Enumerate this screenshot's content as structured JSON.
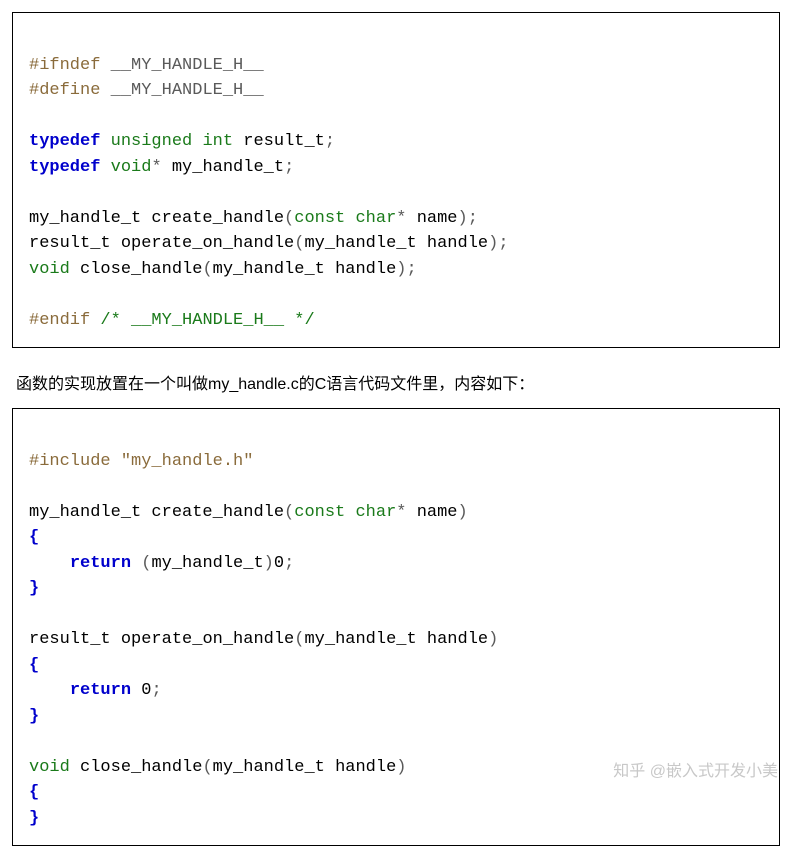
{
  "block1": {
    "l1": {
      "pp": "#ifndef",
      "mac": " __MY_HANDLE_H__"
    },
    "l2": {
      "pp": "#define",
      "mac": " __MY_HANDLE_H__"
    },
    "l3": "",
    "l4": {
      "kw": "typedef",
      "sp1": " ",
      "t1": "unsigned",
      "sp2": " ",
      "t2": "int",
      "sp3": " ",
      "id": "result_t",
      "semi": ";"
    },
    "l5": {
      "kw": "typedef",
      "sp1": " ",
      "t1": "void",
      "star": "*",
      "sp2": " ",
      "id": "my_handle_t",
      "semi": ";"
    },
    "l6": "",
    "l7": {
      "ret": "my_handle_t ",
      "fn": "create_handle",
      "op": "(",
      "ckw": "const",
      "sp1": " ",
      "ch": "char",
      "star": "*",
      "sp2": " ",
      "arg": "name",
      "cp": ")",
      "semi": ";"
    },
    "l8": {
      "ret": "result_t ",
      "fn": "operate_on_handle",
      "op": "(",
      "argtype": "my_handle_t ",
      "arg": "handle",
      "cp": ")",
      "semi": ";"
    },
    "l9": {
      "ret": "void",
      "sp": " ",
      "fn": "close_handle",
      "op": "(",
      "argtype": "my_handle_t ",
      "arg": "handle",
      "cp": ")",
      "semi": ";"
    },
    "l10": "",
    "l11": {
      "pp": "#endif",
      "sp": " ",
      "cmt": "/* __MY_HANDLE_H__ */"
    }
  },
  "prose": "函数的实现放置在一个叫做my_handle.c的C语言代码文件里，内容如下：",
  "block2": {
    "l1": {
      "pp": "#include",
      "sp": " ",
      "str": "\"my_handle.h\""
    },
    "l2": "",
    "l3": {
      "ret": "my_handle_t ",
      "fn": "create_handle",
      "op": "(",
      "ckw": "const",
      "sp1": " ",
      "ch": "char",
      "star": "*",
      "sp2": " ",
      "arg": "name",
      "cp": ")"
    },
    "l4": {
      "brace": "{"
    },
    "l5": {
      "indent": "    ",
      "kw": "return",
      "sp": " ",
      "op": "(",
      "cast": "my_handle_t",
      "cp": ")",
      "val": "0",
      "semi": ";"
    },
    "l6": {
      "brace": "}"
    },
    "l7": "",
    "l8": {
      "ret": "result_t ",
      "fn": "operate_on_handle",
      "op": "(",
      "argtype": "my_handle_t ",
      "arg": "handle",
      "cp": ")"
    },
    "l9": {
      "brace": "{"
    },
    "l10": {
      "indent": "    ",
      "kw": "return",
      "sp": " ",
      "val": "0",
      "semi": ";"
    },
    "l11": {
      "brace": "}"
    },
    "l12": "",
    "l13": {
      "ret": "void",
      "sp": " ",
      "fn": "close_handle",
      "op": "(",
      "argtype": "my_handle_t ",
      "arg": "handle",
      "cp": ")"
    },
    "l14": {
      "brace": "{"
    },
    "l15": {
      "brace": "}"
    }
  },
  "watermark": "知乎 @嵌入式开发小美"
}
